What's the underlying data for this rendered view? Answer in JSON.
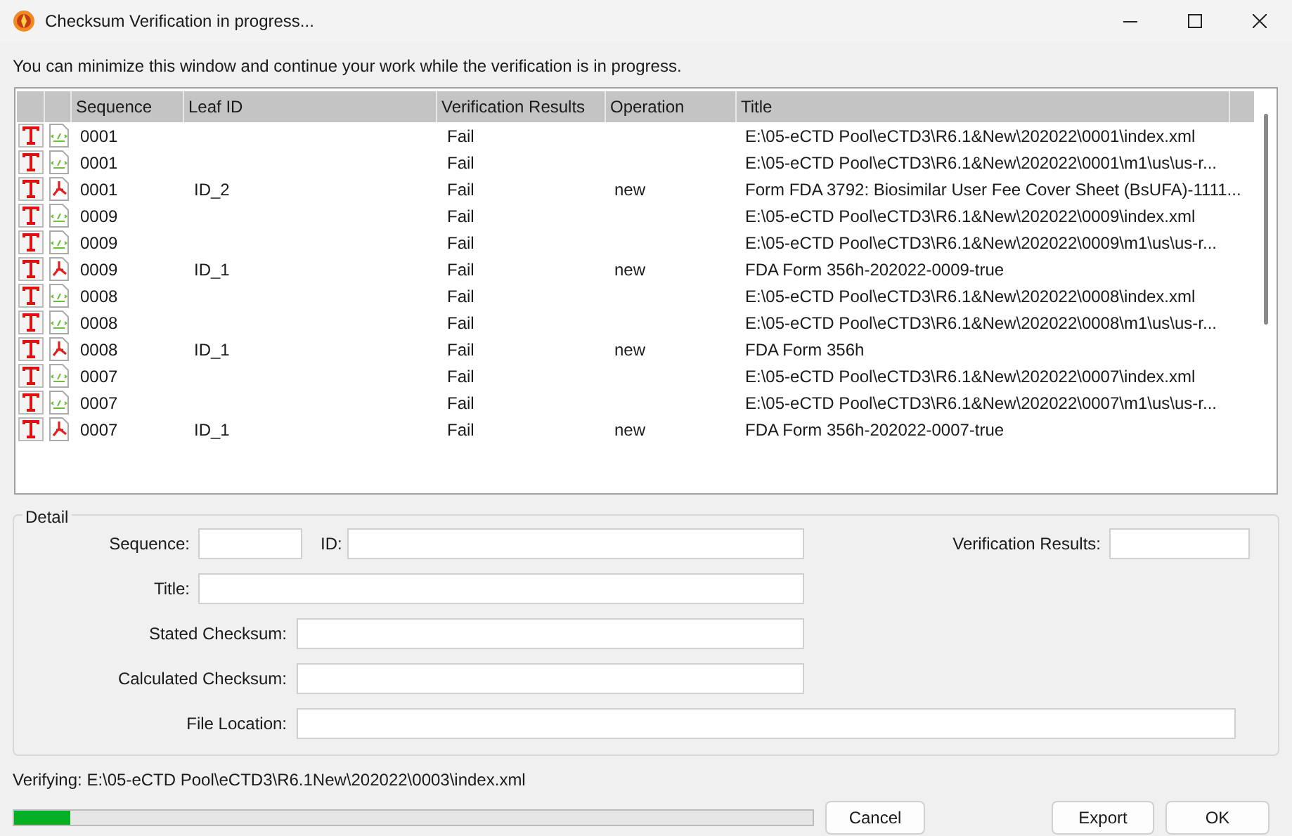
{
  "window": {
    "title": "Checksum Verification in progress..."
  },
  "info": "You can minimize this window and continue your work while the verification is in progress.",
  "table": {
    "columns": [
      "Sequence",
      "Leaf ID",
      "Verification Results",
      "Operation",
      "Title"
    ],
    "rows": [
      {
        "kind": "xml",
        "sequence": "0001",
        "leaf_id": "",
        "result": "Fail",
        "operation": "",
        "title": "E:\\05-eCTD Pool\\eCTD3\\R6.1&New\\202022\\0001\\index.xml"
      },
      {
        "kind": "xml",
        "sequence": "0001",
        "leaf_id": "",
        "result": "Fail",
        "operation": "",
        "title": "E:\\05-eCTD Pool\\eCTD3\\R6.1&New\\202022\\0001\\m1\\us\\us-r..."
      },
      {
        "kind": "pdf",
        "sequence": "0001",
        "leaf_id": "ID_2",
        "result": "Fail",
        "operation": "new",
        "title": "Form FDA 3792: Biosimilar User Fee Cover Sheet (BsUFA)-1111..."
      },
      {
        "kind": "xml",
        "sequence": "0009",
        "leaf_id": "",
        "result": "Fail",
        "operation": "",
        "title": "E:\\05-eCTD Pool\\eCTD3\\R6.1&New\\202022\\0009\\index.xml"
      },
      {
        "kind": "xml",
        "sequence": "0009",
        "leaf_id": "",
        "result": "Fail",
        "operation": "",
        "title": "E:\\05-eCTD Pool\\eCTD3\\R6.1&New\\202022\\0009\\m1\\us\\us-r..."
      },
      {
        "kind": "pdf",
        "sequence": "0009",
        "leaf_id": "ID_1",
        "result": "Fail",
        "operation": "new",
        "title": "FDA Form 356h-202022-0009-true"
      },
      {
        "kind": "xml",
        "sequence": "0008",
        "leaf_id": "",
        "result": "Fail",
        "operation": "",
        "title": "E:\\05-eCTD Pool\\eCTD3\\R6.1&New\\202022\\0008\\index.xml"
      },
      {
        "kind": "xml",
        "sequence": "0008",
        "leaf_id": "",
        "result": "Fail",
        "operation": "",
        "title": "E:\\05-eCTD Pool\\eCTD3\\R6.1&New\\202022\\0008\\m1\\us\\us-r..."
      },
      {
        "kind": "pdf",
        "sequence": "0008",
        "leaf_id": "ID_1",
        "result": "Fail",
        "operation": "new",
        "title": "FDA Form 356h"
      },
      {
        "kind": "xml",
        "sequence": "0007",
        "leaf_id": "",
        "result": "Fail",
        "operation": "",
        "title": "E:\\05-eCTD Pool\\eCTD3\\R6.1&New\\202022\\0007\\index.xml"
      },
      {
        "kind": "xml",
        "sequence": "0007",
        "leaf_id": "",
        "result": "Fail",
        "operation": "",
        "title": "E:\\05-eCTD Pool\\eCTD3\\R6.1&New\\202022\\0007\\m1\\us\\us-r..."
      },
      {
        "kind": "pdf",
        "sequence": "0007",
        "leaf_id": "ID_1",
        "result": "Fail",
        "operation": "new",
        "title": "FDA Form 356h-202022-0007-true"
      }
    ]
  },
  "detail": {
    "title": "Detail",
    "sequence_label": "Sequence:",
    "id_label": "ID:",
    "results_label": "Verification Results:",
    "title_label": "Title:",
    "stated_label": "Stated Checksum:",
    "calculated_label": "Calculated Checksum:",
    "location_label": "File Location:"
  },
  "status": "Verifying: E:\\05-eCTD Pool\\eCTD3\\R6.1New\\202022\\0003\\index.xml",
  "progress": {
    "level": 0.07
  },
  "buttons": {
    "cancel": "Cancel",
    "export": "Export",
    "ok": "OK"
  }
}
